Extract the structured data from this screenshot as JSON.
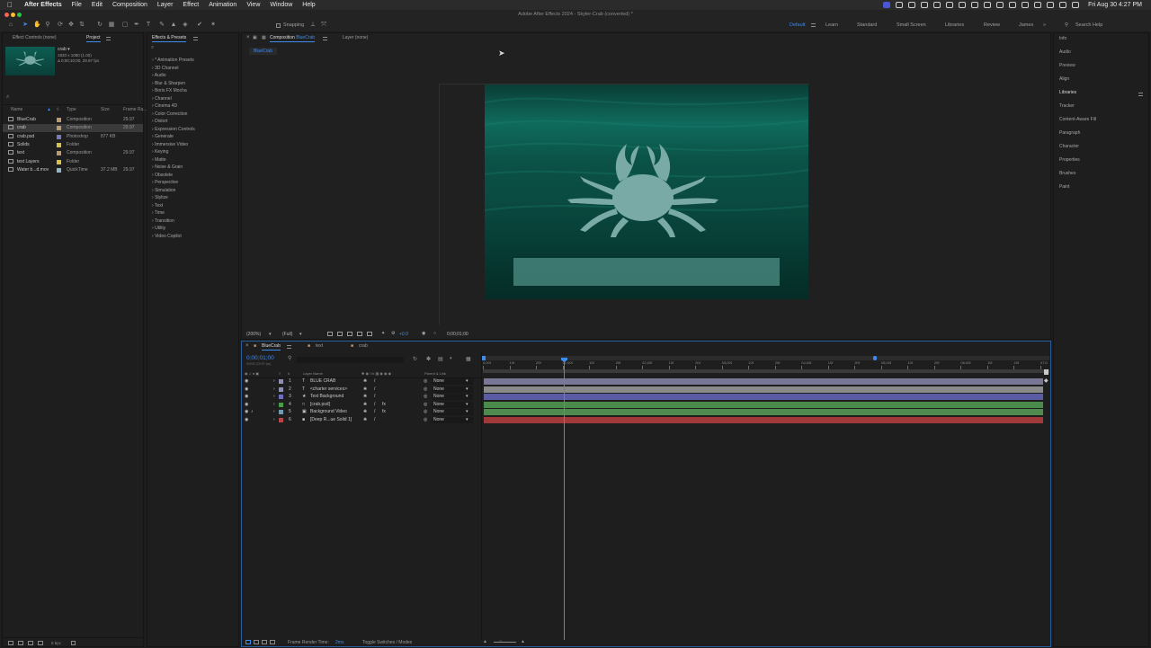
{
  "menubar": {
    "app_name": "After Effects",
    "items": [
      "File",
      "Edit",
      "Composition",
      "Layer",
      "Effect",
      "Animation",
      "View",
      "Window",
      "Help"
    ],
    "datetime": "Fri Aug 30  4:27 PM"
  },
  "window_title": "Adobe After Effects 2024 - Skyler-Crab (converted) *",
  "toolbar": {
    "snapping_label": "Snapping",
    "workspaces": [
      "Default",
      "Learn",
      "Standard",
      "Small Screen",
      "Libraries",
      "Review",
      "James"
    ],
    "active_workspace": "Default",
    "search_help_placeholder": "Search Help"
  },
  "project_panel": {
    "tab_effect_controls": "Effect Controls (none)",
    "tab_project": "Project",
    "preview": {
      "name": "crab ▾",
      "details_line1": "1920 x 1080 (1.00)",
      "details_line2": "Δ 0;00;10;00, 29.97 fps"
    },
    "search_icon": "⌕",
    "columns": {
      "name": "Name",
      "type": "Type",
      "size": "Size",
      "frame_rate": "Frame Ra..."
    },
    "items": [
      {
        "name": "BlueCrab",
        "type": "Composition",
        "size": "",
        "fps": "29.97",
        "color": "#b99b72",
        "icon": "comp-icon",
        "selected": false
      },
      {
        "name": "crab",
        "type": "Composition",
        "size": "",
        "fps": "29.97",
        "color": "#b99b72",
        "icon": "comp-icon",
        "selected": true
      },
      {
        "name": "crab.psd",
        "type": "Photoshop",
        "size": "877 KB",
        "fps": "",
        "color": "#7a7ab8",
        "icon": "psd-icon",
        "selected": false
      },
      {
        "name": "Solids",
        "type": "Folder",
        "size": "",
        "fps": "",
        "color": "#d9c24a",
        "icon": "folder-icon",
        "selected": false
      },
      {
        "name": "text",
        "type": "Composition",
        "size": "",
        "fps": "29.97",
        "color": "#b99b72",
        "icon": "comp-icon",
        "selected": false
      },
      {
        "name": "text Layers",
        "type": "Folder",
        "size": "",
        "fps": "",
        "color": "#d9c24a",
        "icon": "folder-icon",
        "selected": false
      },
      {
        "name": "Water b...d.mov",
        "type": "QuickTime",
        "size": "37.2 MB",
        "fps": "29.97",
        "color": "#8fb6c4",
        "icon": "footage-icon",
        "selected": false
      }
    ],
    "footer_bpc": "8 bpc"
  },
  "effects_panel": {
    "tab_label": "Effects & Presets",
    "search_icon": "⌕",
    "categories": [
      "* Animation Presets",
      "3D Channel",
      "Audio",
      "Blur & Sharpen",
      "Boris FX Mocha",
      "Channel",
      "Cinema 4D",
      "Color Correction",
      "Distort",
      "Expression Controls",
      "Generate",
      "Immersive Video",
      "Keying",
      "Matte",
      "Noise & Grain",
      "Obsolete",
      "Perspective",
      "Simulation",
      "Stylize",
      "Text",
      "Time",
      "Transition",
      "Utility",
      "Video Copilot"
    ]
  },
  "composition_panel": {
    "tab_composition_prefix": "Composition",
    "tab_composition_name": "BlueCrab",
    "tab_layer": "Layer (none)",
    "flowchart_tab": "BlueCrab",
    "footer": {
      "zoom": "(200%)",
      "resolution": "(Full)",
      "exposure": "+0.0",
      "timecode": "0;00;01;00"
    }
  },
  "right_panels": [
    "Info",
    "Audio",
    "Preview",
    "Align",
    "Libraries",
    "Tracker",
    "Content-Aware Fill",
    "Paragraph",
    "Character",
    "Properties",
    "Brushes",
    "Paint"
  ],
  "right_active": "Libraries",
  "timeline": {
    "tabs": [
      "BlueCrab",
      "text",
      "crab"
    ],
    "current_time": "0;00;01;00",
    "current_frames": "00030 (29.97 fps)",
    "col_layer_name": "Layer Name",
    "col_parent": "Parent & Link",
    "layers": [
      {
        "num": "1",
        "name": "BLUE CRAB",
        "type_icon": "T",
        "label_color": "#8f8fb2",
        "parent": "None",
        "bar_color": "#787896"
      },
      {
        "num": "2",
        "name": "<charter services>",
        "type_icon": "T",
        "label_color": "#8f8fb2",
        "parent": "None",
        "bar_color": "#8a8a8a"
      },
      {
        "num": "3",
        "name": "Text Background",
        "type_icon": "★",
        "label_color": "#6f6fbd",
        "parent": "None",
        "bar_color": "#5b5ba3"
      },
      {
        "num": "4",
        "name": "[crab.psd]",
        "type_icon": "□",
        "label_color": "#4a9e4a",
        "parent": "None",
        "bar_color": "#4a8a4a"
      },
      {
        "num": "5",
        "name": "Background Video",
        "type_icon": "▣",
        "label_color": "#6f9ab0",
        "parent": "None",
        "bar_color": "#4f8a4f"
      },
      {
        "num": "6",
        "name": "[Deep R...ue Solid 1]",
        "type_icon": "■",
        "label_color": "#b84545",
        "parent": "None",
        "bar_color": "#a03a3a"
      }
    ],
    "ruler_labels": [
      "0;00f",
      "10f",
      "20f",
      "01;00f",
      "10f",
      "20f",
      "02;00f",
      "10f",
      "20f",
      "03;00f",
      "10f",
      "20f",
      "04;00f",
      "10f",
      "20f",
      "05;00f",
      "10f",
      "20f",
      "06;00f",
      "10f",
      "20f",
      "07;0"
    ],
    "playhead_fraction": 0.1,
    "footer_render_label": "Frame Render Time:",
    "footer_render_value": "2ms",
    "footer_toggle": "Toggle Switches / Modes"
  },
  "colors": {
    "accent": "#3d8cf2",
    "comp_bg_dark": "#062a26",
    "comp_bg_teal": "#0f6b5d",
    "crab": "#7aaaa6",
    "text_box": "#4f8f86"
  }
}
